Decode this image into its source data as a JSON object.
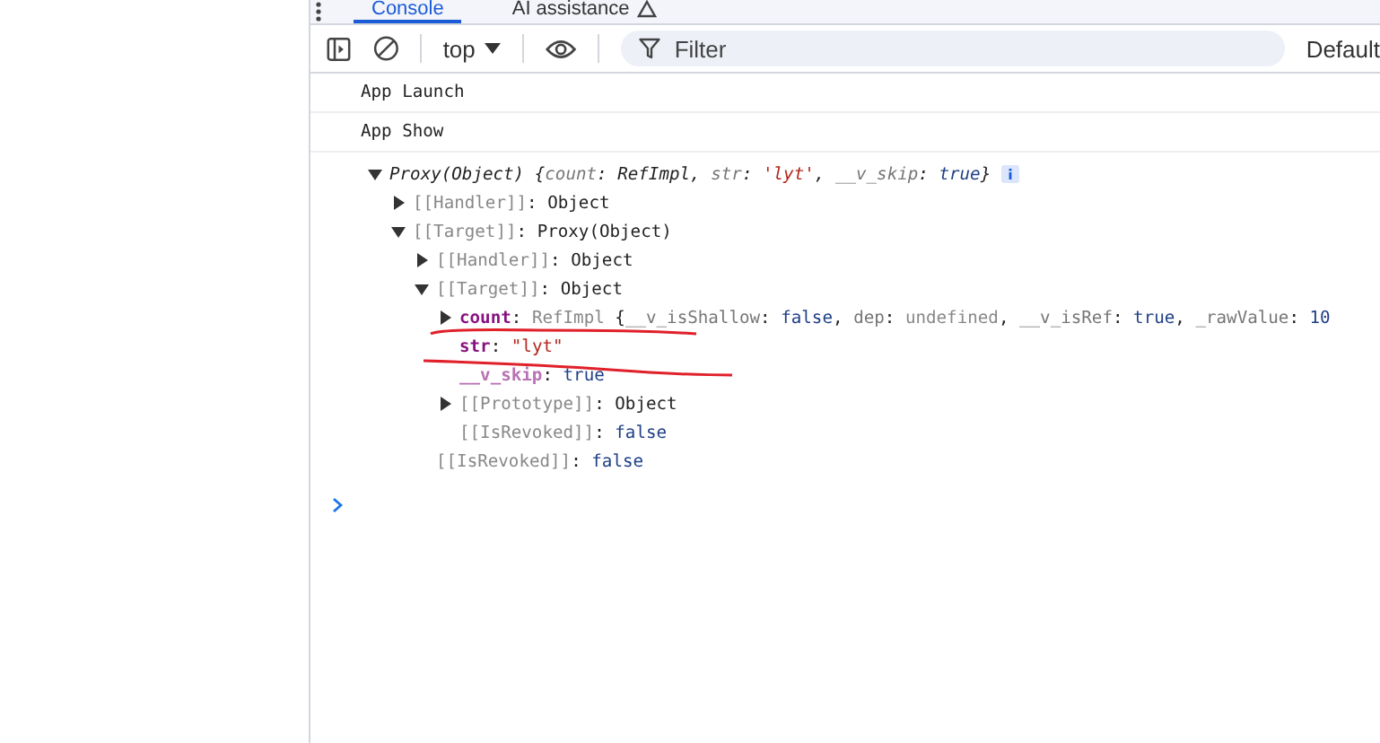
{
  "tabs": [
    {
      "label": "Console",
      "selected": true,
      "warning": false
    },
    {
      "label": "AI assistance",
      "selected": false,
      "warning": true
    }
  ],
  "toolbar": {
    "context": "top",
    "filter": {
      "placeholder": "Filter"
    },
    "levels": "Default"
  },
  "messages": [
    "App Launch",
    "App Show"
  ],
  "tree": [
    {
      "expanded": true,
      "info_badge": true,
      "tokens": [
        {
          "text": "Proxy(Object)",
          "kind": "plain"
        },
        {
          "text": "  {",
          "kind": "plain"
        },
        {
          "text": "count",
          "kind": "preview-key"
        },
        {
          "text": ": ",
          "kind": "plain"
        },
        {
          "text": "RefImpl",
          "kind": "plain"
        },
        {
          "text": ", ",
          "kind": "plain"
        },
        {
          "text": "str",
          "kind": "preview-key"
        },
        {
          "text": ": ",
          "kind": "plain"
        },
        {
          "text": "'lyt'",
          "kind": "string"
        },
        {
          "text": ", ",
          "kind": "plain"
        },
        {
          "text": "__v_skip",
          "kind": "preview-key"
        },
        {
          "text": ": ",
          "kind": "plain"
        },
        {
          "text": "true",
          "kind": "keyword"
        },
        {
          "text": "}",
          "kind": "plain"
        }
      ],
      "children": [
        {
          "expanded": false,
          "tokens": [
            {
              "text": "[[Handler]]",
              "kind": "internal-key"
            },
            {
              "text": ": Object",
              "kind": "plain"
            }
          ]
        },
        {
          "expanded": true,
          "tokens": [
            {
              "text": "[[Target]]",
              "kind": "internal-key"
            },
            {
              "text": ": Proxy(Object)",
              "kind": "plain"
            }
          ],
          "children": [
            {
              "expanded": false,
              "tokens": [
                {
                  "text": "[[Handler]]",
                  "kind": "internal-key"
                },
                {
                  "text": ": Object",
                  "kind": "plain"
                }
              ]
            },
            {
              "expanded": true,
              "tokens": [
                {
                  "text": "[[Target]]",
                  "kind": "internal-key"
                },
                {
                  "text": ": Object",
                  "kind": "plain"
                }
              ],
              "children": [
                {
                  "expanded": false,
                  "tokens": [
                    {
                      "text": "count",
                      "kind": "own-key"
                    },
                    {
                      "text": ": ",
                      "kind": "plain"
                    },
                    {
                      "text": "RefImpl",
                      "kind": "dim"
                    },
                    {
                      "text": "  {",
                      "kind": "plain"
                    },
                    {
                      "text": "__v_isShallow",
                      "kind": "preview-key"
                    },
                    {
                      "text": ": ",
                      "kind": "plain"
                    },
                    {
                      "text": "false",
                      "kind": "keyword"
                    },
                    {
                      "text": ", ",
                      "kind": "plain"
                    },
                    {
                      "text": "dep",
                      "kind": "preview-key"
                    },
                    {
                      "text": ": ",
                      "kind": "plain"
                    },
                    {
                      "text": "undefined",
                      "kind": "dim"
                    },
                    {
                      "text": ", ",
                      "kind": "plain"
                    },
                    {
                      "text": "__v_isRef",
                      "kind": "preview-key"
                    },
                    {
                      "text": ": ",
                      "kind": "plain"
                    },
                    {
                      "text": "true",
                      "kind": "keyword"
                    },
                    {
                      "text": ", ",
                      "kind": "plain"
                    },
                    {
                      "text": "_rawValue",
                      "kind": "preview-key"
                    },
                    {
                      "text": ": ",
                      "kind": "plain"
                    },
                    {
                      "text": "10",
                      "kind": "keyword"
                    }
                  ]
                },
                {
                  "tokens": [
                    {
                      "text": "str",
                      "kind": "own-key"
                    },
                    {
                      "text": ": ",
                      "kind": "plain"
                    },
                    {
                      "text": "\"lyt\"",
                      "kind": "string"
                    }
                  ]
                },
                {
                  "tokens": [
                    {
                      "text": "__v_skip",
                      "kind": "hidden-key"
                    },
                    {
                      "text": ": ",
                      "kind": "plain"
                    },
                    {
                      "text": "true",
                      "kind": "keyword"
                    }
                  ]
                },
                {
                  "expanded": false,
                  "tokens": [
                    {
                      "text": "[[Prototype]]",
                      "kind": "internal-key"
                    },
                    {
                      "text": ": Object",
                      "kind": "plain"
                    }
                  ]
                },
                {
                  "tokens": [
                    {
                      "text": "[[IsRevoked]]",
                      "kind": "internal-key"
                    },
                    {
                      "text": ": ",
                      "kind": "plain"
                    },
                    {
                      "text": "false",
                      "kind": "keyword"
                    }
                  ]
                }
              ]
            },
            {
              "tokens": [
                {
                  "text": "[[IsRevoked]]",
                  "kind": "internal-key"
                },
                {
                  "text": ": ",
                  "kind": "plain"
                },
                {
                  "text": "false",
                  "kind": "keyword"
                }
              ]
            }
          ]
        }
      ]
    }
  ]
}
